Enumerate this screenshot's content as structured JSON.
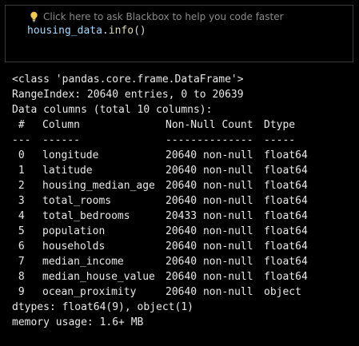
{
  "input_cell": {
    "hint_text": "Click here to ask Blackbox to help you code faster",
    "hint_icon": "lightbulb-icon",
    "code": {
      "object": "housing_data",
      "dot": ".",
      "method": "info",
      "parens": "()"
    }
  },
  "output": {
    "class_line": "<class 'pandas.core.frame.DataFrame'>",
    "range_index": "RangeIndex: 20640 entries, 0 to 20639",
    "data_columns": "Data columns (total 10 columns):",
    "header": {
      "num": " #",
      "column": "Column",
      "non_null": "Non-Null Count",
      "dtype": "Dtype"
    },
    "separator": {
      "num": "---",
      "column": "------",
      "non_null": "--------------",
      "dtype": "-----"
    },
    "rows": [
      {
        "num": " 0",
        "column": "longitude",
        "non_null": "20640 non-null",
        "dtype": "float64"
      },
      {
        "num": " 1",
        "column": "latitude",
        "non_null": "20640 non-null",
        "dtype": "float64"
      },
      {
        "num": " 2",
        "column": "housing_median_age",
        "non_null": "20640 non-null",
        "dtype": "float64"
      },
      {
        "num": " 3",
        "column": "total_rooms",
        "non_null": "20640 non-null",
        "dtype": "float64"
      },
      {
        "num": " 4",
        "column": "total_bedrooms",
        "non_null": "20433 non-null",
        "dtype": "float64"
      },
      {
        "num": " 5",
        "column": "population",
        "non_null": "20640 non-null",
        "dtype": "float64"
      },
      {
        "num": " 6",
        "column": "households",
        "non_null": "20640 non-null",
        "dtype": "float64"
      },
      {
        "num": " 7",
        "column": "median_income",
        "non_null": "20640 non-null",
        "dtype": "float64"
      },
      {
        "num": " 8",
        "column": "median_house_value",
        "non_null": "20640 non-null",
        "dtype": "float64"
      },
      {
        "num": " 9",
        "column": "ocean_proximity",
        "non_null": "20640 non-null",
        "dtype": "object"
      }
    ],
    "dtypes_line": "dtypes: float64(9), object(1)",
    "memory_line": "memory usage: 1.6+ MB"
  },
  "colors": {
    "background": "#000000",
    "output_text": "#e8e8e8",
    "hint_text": "#8a8a8a",
    "variable": "#9cdcfe",
    "function": "#dcdcaa",
    "bulb": "#f2c94c",
    "cell_border": "#3a3a3a"
  }
}
